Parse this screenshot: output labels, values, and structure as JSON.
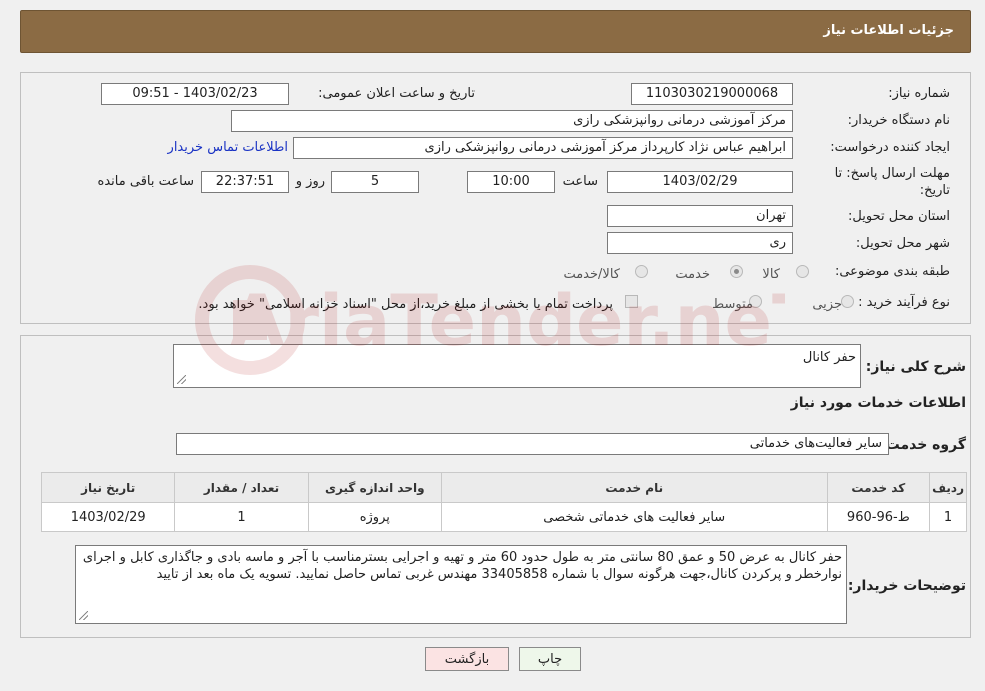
{
  "header": {
    "title": "جزئیات اطلاعات نیاز"
  },
  "info": {
    "need_number_label": "شماره نیاز:",
    "need_number": "1103030219000068",
    "announce_label": "تاریخ و ساعت اعلان عمومی:",
    "announce_value": "1403/02/23 - 09:51",
    "buyer_org_label": "نام دستگاه خریدار:",
    "buyer_org": "مرکز آموزشی درمانی روانپزشکی رازی",
    "creator_label": "ایجاد کننده درخواست:",
    "creator": "ابراهیم عباس نژاد کارپرداز مرکز آموزشی درمانی روانپزشکی رازی",
    "contact_link": "اطلاعات تماس خریدار",
    "deadline_label": "مهلت ارسال پاسخ: تا",
    "deadline_label2": "تاریخ:",
    "deadline_date": "1403/02/29",
    "time_label": "ساعت",
    "deadline_time": "10:00",
    "days_value": "5",
    "days_label": "روز و",
    "remaining_time": "22:37:51",
    "remaining_label": "ساعت باقی مانده",
    "province_label": "استان محل تحویل:",
    "province": "تهران",
    "city_label": "شهر محل تحویل:",
    "city": "ری",
    "category_label": "طبقه بندی موضوعی:",
    "category_options": [
      "کالا",
      "خدمت",
      "کالا/خدمت"
    ],
    "category_selected": "خدمت",
    "process_label": "نوع فرآیند خرید :",
    "process_options": [
      "جزیی",
      "متوسط"
    ],
    "payment_note": "پرداخت تمام یا بخشی از مبلغ خرید،از محل \"اسناد خزانه اسلامی\" خواهد بود."
  },
  "details": {
    "summary_label": "شرح کلی نیاز:",
    "summary": "حفر کانال",
    "services_title": "اطلاعات خدمات مورد نیاز",
    "group_label": "گروه خدمت:",
    "group_value": "سایر فعالیت‌های خدماتی",
    "table": {
      "headers": [
        "ردیف",
        "کد خدمت",
        "نام خدمت",
        "واحد اندازه گیری",
        "تعداد / مقدار",
        "تاریخ نیاز"
      ],
      "rows": [
        [
          "1",
          "ط-96-960",
          "سایر فعالیت های خدماتی شخصی",
          "پروژه",
          "1",
          "1403/02/29"
        ]
      ]
    },
    "buyer_notes_label": "توضیحات خریدار:",
    "buyer_notes": "حفر کانال به عرض 50 و عمق 80 سانتی متر  به طول حدود  60 متر و تهیه و اجرایی بسترمناسب با آجر و ماسه بادی و جاگذاری کابل و اجرای نوارخطر و پرکردن کانال،جهت هرگونه سوال با شماره 33405858 مهندس غربی تماس حاصل نمایید. تسویه یک ماه بعد از تایید"
  },
  "buttons": {
    "print": "چاپ",
    "back": "بازگشت"
  },
  "watermark": {
    "text": "AriaTender.neT",
    "color": "#b01010"
  }
}
